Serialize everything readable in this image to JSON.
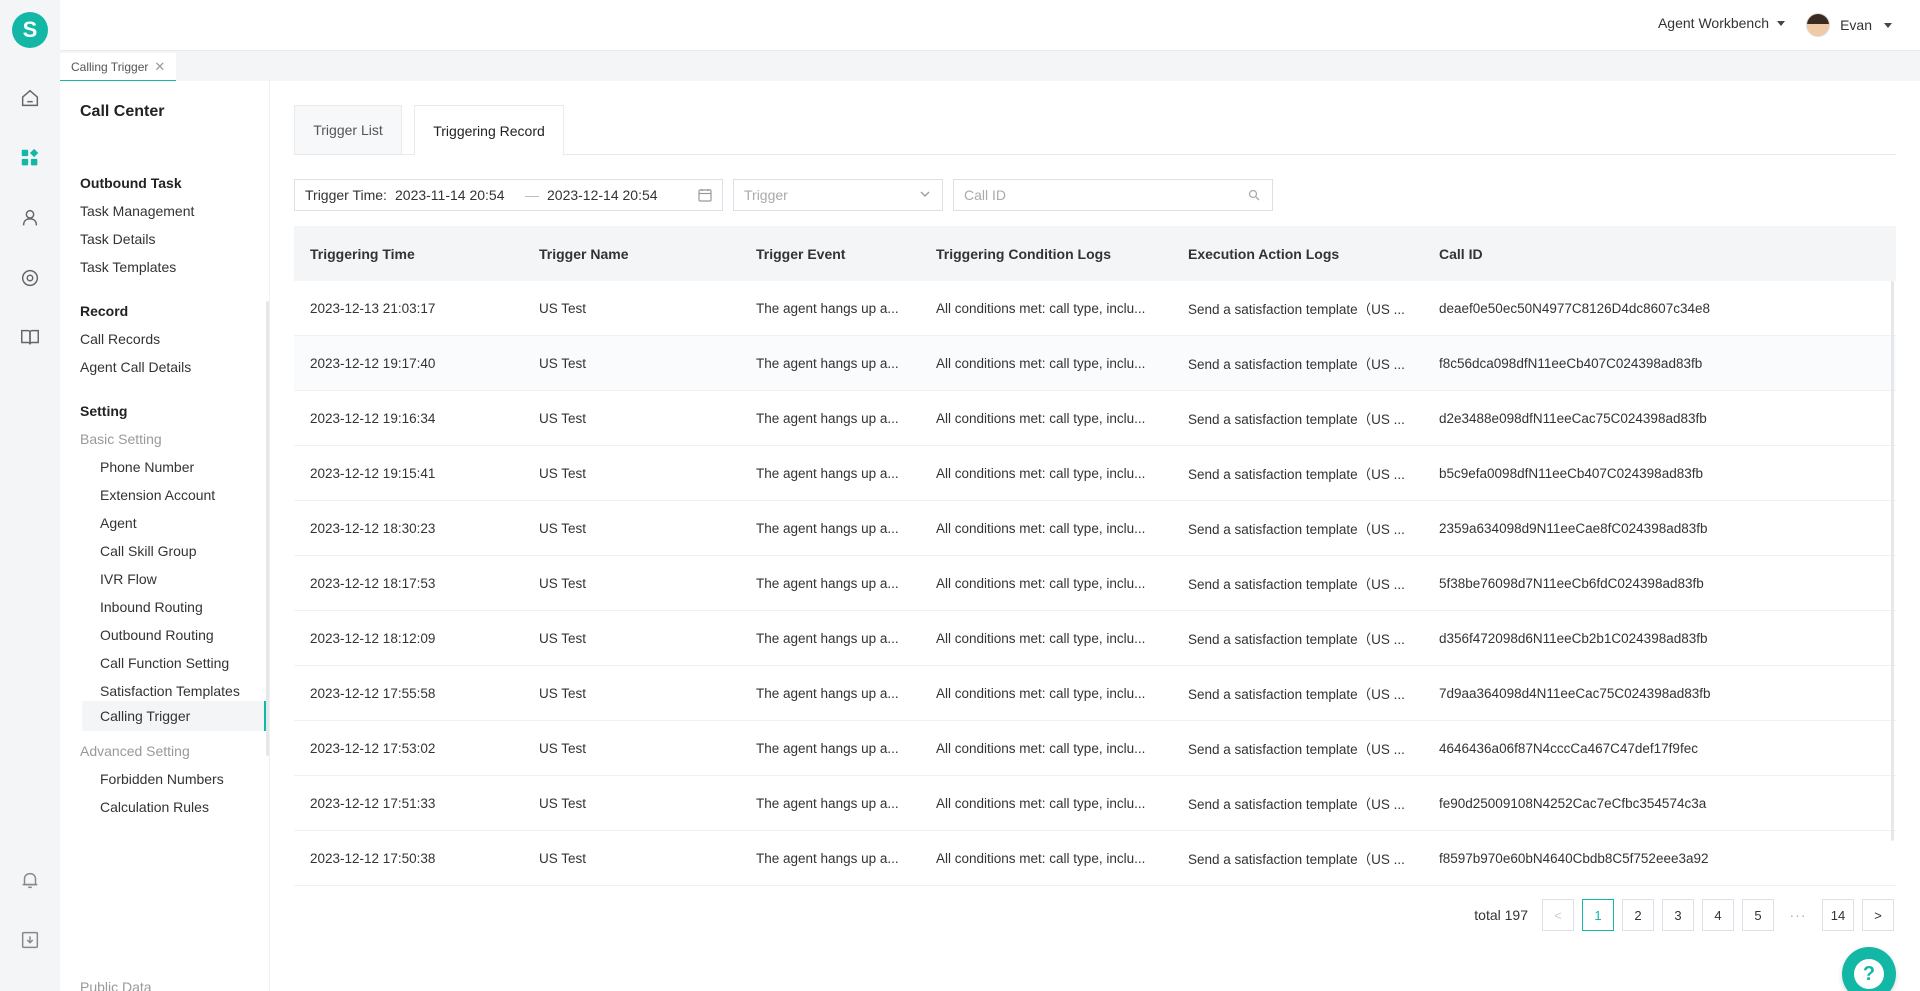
{
  "colors": {
    "accent": "#13b7a6"
  },
  "logo": {
    "letter": "S"
  },
  "header": {
    "workbench": "Agent Workbench",
    "user_name": "Evan"
  },
  "page_tab": {
    "label": "Calling Trigger",
    "close": "✕"
  },
  "sidebar": {
    "title": "Call Center",
    "items": {
      "outbound_task": "Outbound Task",
      "task_management": "Task Management",
      "task_details": "Task Details",
      "task_templates": "Task Templates",
      "record": "Record",
      "call_records": "Call Records",
      "agent_call_details": "Agent Call Details",
      "setting": "Setting",
      "basic_setting": "Basic Setting",
      "phone_number": "Phone Number",
      "extension_account": "Extension Account",
      "agent": "Agent",
      "call_skill_group": "Call Skill Group",
      "ivr_flow": "IVR Flow",
      "inbound_routing": "Inbound Routing",
      "outbound_routing": "Outbound Routing",
      "call_function_setting": "Call Function Setting",
      "satisfaction_templates": "Satisfaction Templates",
      "calling_trigger": "Calling Trigger",
      "advanced_setting": "Advanced Setting",
      "forbidden_numbers": "Forbidden Numbers",
      "calculation_rules": "Calculation Rules",
      "public_data": "Public Data"
    }
  },
  "tabs": {
    "trigger_list": "Trigger List",
    "triggering_record": "Triggering Record"
  },
  "filters": {
    "trigger_time_label": "Trigger Time:",
    "start": "2023-11-14 20:54",
    "separator": "—",
    "end": "2023-12-14 20:54",
    "trigger_placeholder": "Trigger",
    "call_id_placeholder": "Call ID"
  },
  "table": {
    "headers": [
      "Triggering Time",
      "Trigger Name",
      "Trigger Event",
      "Triggering Condition Logs",
      "Execution Action Logs",
      "Call ID"
    ],
    "rows": [
      [
        "2023-12-13 21:03:17",
        "US Test",
        "The agent hangs up a...",
        "All conditions met: call type, inclu...",
        "Send a satisfaction template（US ...",
        "deaef0e50ec50N4977C8126D4dc8607c34e8"
      ],
      [
        "2023-12-12 19:17:40",
        "US Test",
        "The agent hangs up a...",
        "All conditions met: call type, inclu...",
        "Send a satisfaction template（US ...",
        "f8c56dca098dfN11eeCb407C024398ad83fb"
      ],
      [
        "2023-12-12 19:16:34",
        "US Test",
        "The agent hangs up a...",
        "All conditions met: call type, inclu...",
        "Send a satisfaction template（US ...",
        "d2e3488e098dfN11eeCac75C024398ad83fb"
      ],
      [
        "2023-12-12 19:15:41",
        "US Test",
        "The agent hangs up a...",
        "All conditions met: call type, inclu...",
        "Send a satisfaction template（US ...",
        "b5c9efa0098dfN11eeCb407C024398ad83fb"
      ],
      [
        "2023-12-12 18:30:23",
        "US Test",
        "The agent hangs up a...",
        "All conditions met: call type, inclu...",
        "Send a satisfaction template（US ...",
        "2359a634098d9N11eeCae8fC024398ad83fb"
      ],
      [
        "2023-12-12 18:17:53",
        "US Test",
        "The agent hangs up a...",
        "All conditions met: call type, inclu...",
        "Send a satisfaction template（US ...",
        "5f38be76098d7N11eeCb6fdC024398ad83fb"
      ],
      [
        "2023-12-12 18:12:09",
        "US Test",
        "The agent hangs up a...",
        "All conditions met: call type, inclu...",
        "Send a satisfaction template（US ...",
        "d356f472098d6N11eeCb2b1C024398ad83fb"
      ],
      [
        "2023-12-12 17:55:58",
        "US Test",
        "The agent hangs up a...",
        "All conditions met: call type, inclu...",
        "Send a satisfaction template（US ...",
        "7d9aa364098d4N11eeCac75C024398ad83fb"
      ],
      [
        "2023-12-12 17:53:02",
        "US Test",
        "The agent hangs up a...",
        "All conditions met: call type, inclu...",
        "Send a satisfaction template（US ...",
        "4646436a06f87N4cccCa467C47def17f9fec"
      ],
      [
        "2023-12-12 17:51:33",
        "US Test",
        "The agent hangs up a...",
        "All conditions met: call type, inclu...",
        "Send a satisfaction template（US ...",
        "fe90d25009108N4252Cac7eCfbc354574c3a"
      ],
      [
        "2023-12-12 17:50:38",
        "US Test",
        "The agent hangs up a...",
        "All conditions met: call type, inclu...",
        "Send a satisfaction template（US ...",
        "f8597b970e60bN4640Cbdb8C5f752eee3a92"
      ]
    ]
  },
  "pagination": {
    "total": "total 197",
    "prev": "<",
    "pages": [
      "1",
      "2",
      "3",
      "4",
      "5"
    ],
    "ellipsis": "···",
    "last": "14",
    "next": ">"
  },
  "help": {
    "symbol": "?"
  }
}
